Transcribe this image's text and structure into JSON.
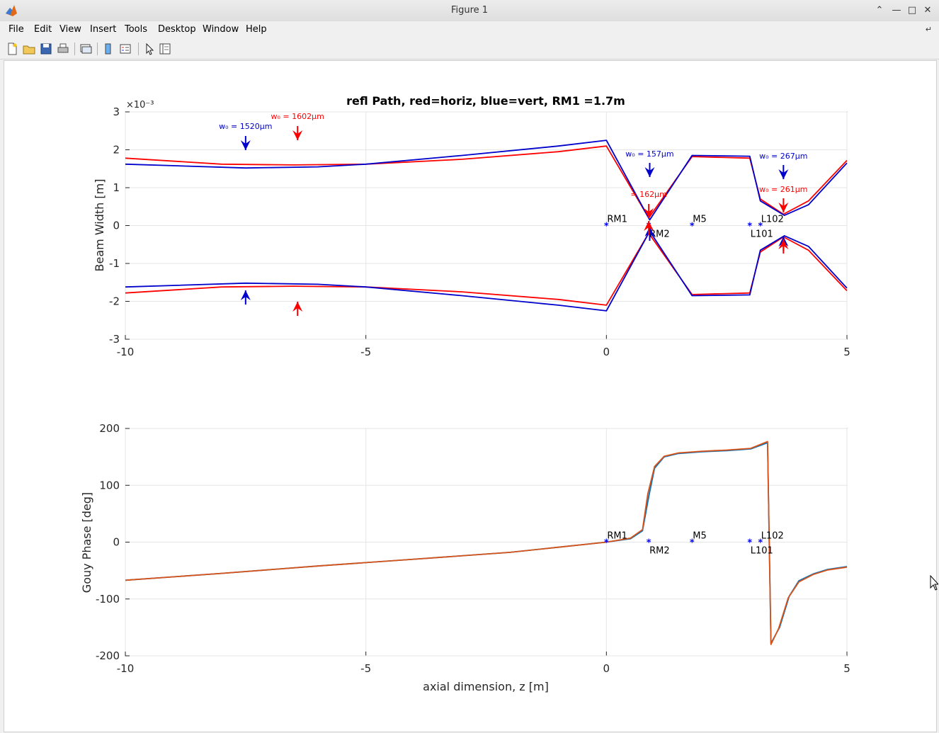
{
  "window": {
    "title": "Figure 1"
  },
  "menu": [
    "File",
    "Edit",
    "View",
    "Insert",
    "Tools",
    "Desktop",
    "Window",
    "Help"
  ],
  "toolbar": {
    "icons": [
      "new-figure-icon",
      "open-file-icon",
      "save-icon",
      "print-icon",
      "link-plot-icon",
      "insert-colorbar-icon",
      "insert-legend-icon",
      "edit-plot-icon",
      "property-inspector-icon"
    ]
  },
  "colors": {
    "horiz": "#ff0000",
    "vert": "#0000cc",
    "gouy1": "#0072bd",
    "gouy2": "#d95319",
    "marker": "#0000ff"
  },
  "chart_data": [
    {
      "type": "line",
      "title": "refl Path, red=horiz, blue=vert, RM1 =1.7m",
      "xlabel": "",
      "ylabel": "Beam Width [m]",
      "xlim": [
        -10,
        5
      ],
      "ylim": [
        -3,
        3
      ],
      "y_exponent": "×10⁻³",
      "xticks": [
        -10,
        -5,
        0,
        5
      ],
      "yticks": [
        -3,
        -2,
        -1,
        0,
        1,
        2,
        3
      ],
      "grid": true,
      "series": [
        {
          "color": "red",
          "x": [
            -10,
            -8,
            -6.5,
            -5,
            -3,
            -1,
            0,
            0.88,
            1.78,
            2.98,
            3.2,
            3.68,
            4.2,
            5
          ],
          "y": [
            1.78,
            1.62,
            1.6,
            1.62,
            1.75,
            1.95,
            2.1,
            0.2,
            1.82,
            1.78,
            0.7,
            0.3,
            0.65,
            1.72
          ],
          "mirror": true
        },
        {
          "color": "blue",
          "x": [
            -10,
            -7.5,
            -6,
            -5,
            -3,
            -1,
            0,
            0.9,
            1.78,
            2.98,
            3.2,
            3.7,
            4.2,
            5
          ],
          "y": [
            1.62,
            1.52,
            1.55,
            1.62,
            1.85,
            2.1,
            2.25,
            0.15,
            1.85,
            1.83,
            0.65,
            0.27,
            0.55,
            1.65
          ],
          "mirror": true
        }
      ],
      "elements": [
        {
          "label": "RM1",
          "x": 0,
          "label_pos": "above"
        },
        {
          "label": "RM2",
          "x": 0.88,
          "label_pos": "below"
        },
        {
          "label": "M5",
          "x": 1.78,
          "label_pos": "above"
        },
        {
          "label": "L101",
          "x": 2.98,
          "label_pos": "below"
        },
        {
          "label": "L102",
          "x": 3.2,
          "label_pos": "above"
        }
      ],
      "waists": [
        {
          "label": "w₀ = 1520μm",
          "x": -7.5,
          "color": "blue"
        },
        {
          "label": "w₀ = 1602μm",
          "x": -6.42,
          "color": "red"
        },
        {
          "label": "w₀ = 157μm",
          "x": 0.9,
          "color": "blue"
        },
        {
          "label": "= 162μm",
          "x": 0.88,
          "color": "red"
        },
        {
          "label": "w₀ = 267μm",
          "x": 3.68,
          "color": "blue"
        },
        {
          "label": "w₀ = 261μm",
          "x": 3.68,
          "color": "red"
        }
      ]
    },
    {
      "type": "line",
      "title": "",
      "xlabel": "axial dimension, z [m]",
      "ylabel": "Gouy Phase [deg]",
      "xlim": [
        -10,
        5
      ],
      "ylim": [
        -200,
        200
      ],
      "xticks": [
        -10,
        -5,
        0,
        5
      ],
      "yticks": [
        -200,
        -100,
        0,
        100,
        200
      ],
      "grid": true,
      "series": [
        {
          "color": "blue",
          "x": [
            -10,
            -8,
            -6,
            -4,
            -2,
            -1,
            0,
            0.5,
            0.75,
            0.88,
            1.0,
            1.2,
            1.5,
            2.0,
            2.5,
            3.0,
            3.35,
            3.42,
            3.6,
            3.8,
            4.0,
            4.3,
            4.6,
            5.0
          ],
          "y": [
            -67,
            -55,
            -42,
            -30,
            -18,
            -9,
            0,
            6,
            20,
            80,
            130,
            150,
            156,
            159,
            161,
            164,
            175,
            -178,
            -150,
            -95,
            -68,
            -56,
            -48,
            -43
          ]
        },
        {
          "color": "orange",
          "x": [
            -10,
            -8,
            -6,
            -4,
            -2,
            -1,
            0,
            0.5,
            0.75,
            0.86,
            1.0,
            1.2,
            1.5,
            2.0,
            2.5,
            3.0,
            3.35,
            3.42,
            3.58,
            3.78,
            4.0,
            4.3,
            4.6,
            5.0
          ],
          "y": [
            -67,
            -55,
            -42,
            -30,
            -18,
            -9,
            0,
            7,
            22,
            85,
            133,
            151,
            157,
            160,
            162,
            165,
            177,
            -180,
            -152,
            -98,
            -70,
            -57,
            -49,
            -44
          ]
        }
      ],
      "elements": [
        {
          "label": "RM1",
          "x": 0,
          "label_pos": "above"
        },
        {
          "label": "RM2",
          "x": 0.88,
          "label_pos": "below"
        },
        {
          "label": "M5",
          "x": 1.78,
          "label_pos": "above"
        },
        {
          "label": "L101",
          "x": 2.98,
          "label_pos": "below"
        },
        {
          "label": "L102",
          "x": 3.2,
          "label_pos": "above"
        }
      ]
    }
  ]
}
